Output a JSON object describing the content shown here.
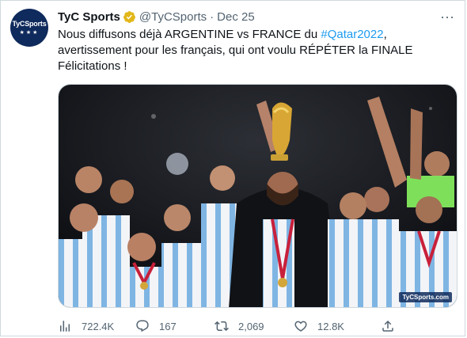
{
  "tweet": {
    "author_name": "TyC Sports",
    "handle": "@TyCSports",
    "separator": "·",
    "date": "Dec 25",
    "avatar_text": "TyCSports",
    "avatar_stars": "★★★",
    "text_line1_prefix": "Nous diffusons déjà ARGENTINE vs FRANCE du ",
    "hashtag": "#Qatar2022",
    "text_line1_suffix": ",",
    "text_line2": "avertissement pour les français, qui ont voulu RÉPÉTER la FINALE",
    "text_line3": "Félicitations !",
    "media_watermark": "TyCSports.com",
    "more_label": "···"
  },
  "actions": {
    "views": "722.4K",
    "replies": "167",
    "retweets": "2,069",
    "likes": "12.8K"
  },
  "icons": {
    "views": "bar-chart-icon",
    "reply": "reply-icon",
    "retweet": "retweet-icon",
    "like": "heart-icon",
    "share": "share-icon",
    "verified": "verified-badge-icon"
  },
  "colors": {
    "link": "#1d9bf0",
    "secondary_text": "#536471",
    "verified_gold": "#e2b719"
  }
}
